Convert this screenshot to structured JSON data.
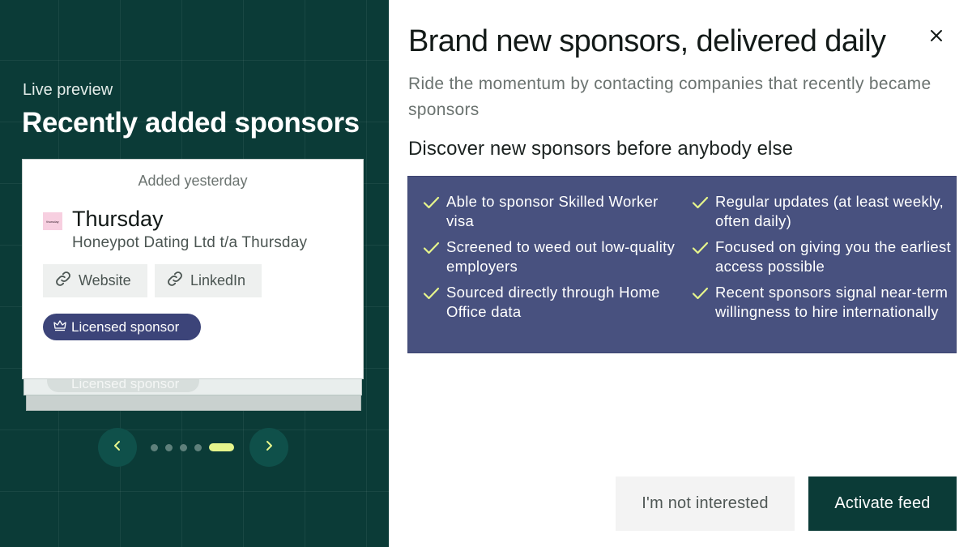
{
  "preview": {
    "label": "Live preview",
    "title": "Recently added sponsors",
    "card": {
      "added": "Added yesterday",
      "logo_text": "thursday",
      "company_name": "Thursday",
      "company_legal": "Honeypot Dating Ltd t/a Thursday",
      "website_label": "Website",
      "linkedin_label": "LinkedIn",
      "badge_label": "Licensed sponsor",
      "ghost_badge_label": "Licensed sponsor"
    },
    "carousel": {
      "total": 5,
      "active_index": 4
    }
  },
  "modal": {
    "title": "Brand new sponsors, delivered daily",
    "subtitle": "Ride the momentum by contacting companies that recently became sponsors",
    "discover_heading": "Discover new sponsors before anybody else",
    "features_left": [
      "Able to sponsor Skilled Worker visa",
      "Screened to weed out low-quality employers",
      "Sourced directly through Home Office data"
    ],
    "features_right": [
      "Regular updates (at least weekly, often daily)",
      "Focused on giving you the earliest access possible",
      "Recent sponsors signal near-term willingness to hire internationally"
    ],
    "secondary_button": "I'm not interested",
    "primary_button": "Activate feed"
  },
  "colors": {
    "panel_bg": "#0b3b37",
    "feature_bg": "#48517f",
    "badge_bg": "#3c4479",
    "check": "#e6f58c",
    "active_dot": "#e6f58c"
  },
  "icons": {
    "link": "link-icon",
    "crown": "crown-icon",
    "check": "check-icon",
    "close": "close-icon",
    "prev": "chevron-left-icon",
    "next": "chevron-right-icon"
  }
}
